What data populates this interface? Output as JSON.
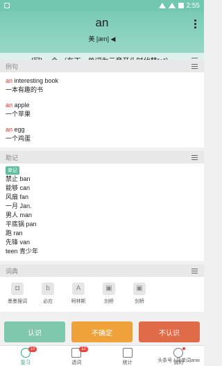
{
  "status": {
    "time": "2:55"
  },
  "header": {
    "word": "an",
    "phonetic": "美 [æn]",
    "def": "[冠] 一个 （在下一单词为元音开头时代替“a”）"
  },
  "examples": {
    "title": "例句",
    "items": [
      {
        "hl": "an",
        "en": " interesting book",
        "zh": "一本有趣的书"
      },
      {
        "hl": "an",
        "en": " apple",
        "zh": "一个苹果"
      },
      {
        "hl": "an",
        "en": " egg",
        "zh": "一个鸡蛋"
      }
    ]
  },
  "memory": {
    "title": "助记",
    "tag": "单记",
    "lines": [
      "禁止 ban",
      "能够 can",
      "风扇 fan",
      "一月 Jan.",
      "男人 man",
      "平底锅 pan",
      "跑 ran",
      "先锋 van",
      "teen 青少年"
    ]
  },
  "dictionary": {
    "title": "词典",
    "items": [
      {
        "label": "墨墨搜词",
        "icon": "momo-icon",
        "glyph": "◘"
      },
      {
        "label": "必应",
        "icon": "bing-icon",
        "glyph": "b"
      },
      {
        "label": "柯林斯",
        "icon": "collins-icon",
        "glyph": "A"
      },
      {
        "label": "剑桥",
        "icon": "cambridge-icon",
        "glyph": "▣"
      },
      {
        "label": "剑桥",
        "icon": "cambridge-icon",
        "glyph": "▣"
      }
    ]
  },
  "actions": {
    "know": "认识",
    "unsure": "不确定",
    "unknown": "不认识"
  },
  "tabs": [
    {
      "label": "复习",
      "badge": "10"
    },
    {
      "label": "透词",
      "badge": "10"
    },
    {
      "label": "统计"
    },
    {
      "label": "我的"
    }
  ],
  "watermark": "头条号 / 背单词anw"
}
